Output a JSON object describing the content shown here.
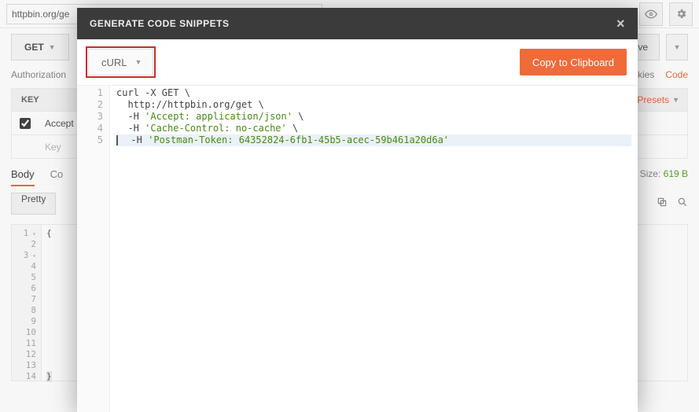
{
  "bg": {
    "url": "httpbin.org/ge",
    "method": "GET",
    "save": "Save",
    "subtabs": {
      "auth": "Authorization"
    },
    "cookies": "Cookies",
    "code": "Code",
    "keyHeader": "KEY",
    "presets": "Presets",
    "acceptLabel": "Accept",
    "keyPlaceholder": "Key",
    "midtabs": {
      "body": "Body",
      "co": "Co"
    },
    "sizeLabel": "Size:",
    "sizeValue": "619 B",
    "pretty": "Pretty",
    "jsonLines": [
      "{",
      "",
      "",
      "",
      "",
      "",
      "",
      "",
      "",
      "",
      "",
      "",
      "",
      "}"
    ]
  },
  "modal": {
    "title": "GENERATE CODE SNIPPETS",
    "language": "cURL",
    "copy": "Copy to Clipboard",
    "code": {
      "l1": "curl -X GET \\",
      "l2": "  http://httpbin.org/get \\",
      "l3a": "  -H ",
      "l3b": "'Accept: application/json'",
      "l3c": " \\",
      "l4a": "  -H ",
      "l4b": "'Cache-Control: no-cache'",
      "l4c": " \\",
      "l5a": "  -H ",
      "l5b": "'Postman-Token: 64352824-6fb1-45b5-acec-59b461a20d6a'"
    }
  }
}
